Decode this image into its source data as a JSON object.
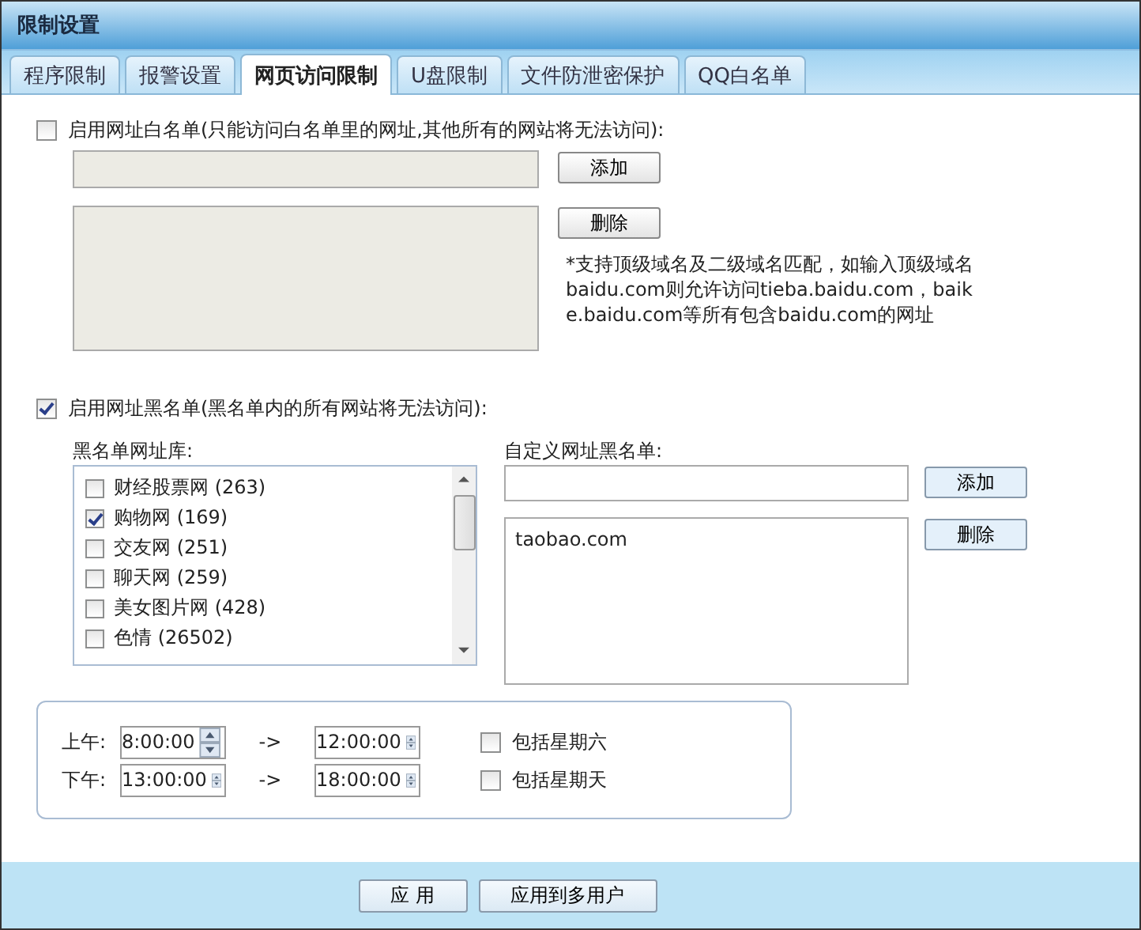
{
  "window": {
    "title": "限制设置"
  },
  "tabs": [
    {
      "label": "程序限制",
      "selected": false
    },
    {
      "label": "报警设置",
      "selected": false
    },
    {
      "label": "网页访问限制",
      "selected": true
    },
    {
      "label": "U盘限制",
      "selected": false
    },
    {
      "label": "文件防泄密保护",
      "selected": false
    },
    {
      "label": "QQ白名单",
      "selected": false
    }
  ],
  "whitelist": {
    "label": "启用网址白名单(只能访问白名单里的网址,其他所有的网站将无法访问):",
    "checked": false,
    "add_button": "添加",
    "delete_button": "删除",
    "note": "*支持顶级域名及二级域名匹配，如输入顶级域名baidu.com则允许访问tieba.baidu.com，baike.baidu.com等所有包含baidu.com的网址"
  },
  "blacklist": {
    "label": "启用网址黑名单(黑名单内的所有网站将无法访问):",
    "checked": true,
    "library_label": "黑名单网址库:",
    "library": [
      {
        "label": "财经股票网 (263)",
        "checked": false
      },
      {
        "label": "购物网 (169)",
        "checked": true
      },
      {
        "label": "交友网 (251)",
        "checked": false
      },
      {
        "label": "聊天网 (259)",
        "checked": false
      },
      {
        "label": "美女图片网 (428)",
        "checked": false
      },
      {
        "label": "色情 (26502)",
        "checked": false
      }
    ],
    "custom_label": "自定义网址黑名单:",
    "custom_entries": [
      "taobao.com"
    ],
    "add_button": "添加",
    "delete_button": "删除"
  },
  "schedule": {
    "rows": [
      {
        "label": "上午:",
        "start": "8:00:00",
        "arrow": "->",
        "end": "12:00:00",
        "weekend_label": "包括星期六",
        "weekend_checked": false
      },
      {
        "label": "下午:",
        "start": "13:00:00",
        "arrow": "->",
        "end": "18:00:00",
        "weekend_label": "包括星期天",
        "weekend_checked": false
      }
    ]
  },
  "footer_buttons": [
    "应 用",
    "应用到多用户"
  ]
}
